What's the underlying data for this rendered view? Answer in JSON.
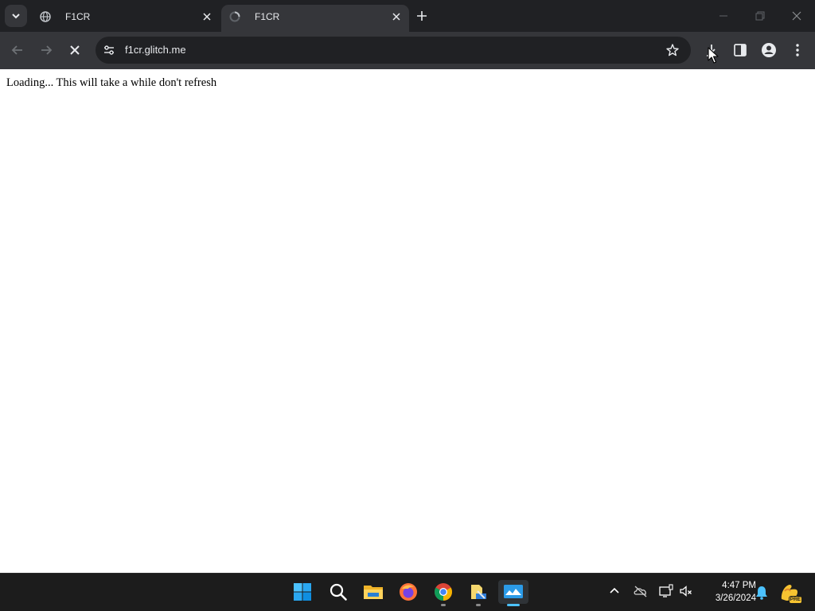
{
  "browser": {
    "tabs": [
      {
        "title": "F1CR",
        "active": false,
        "favicon": "globe-icon"
      },
      {
        "title": "F1CR",
        "active": true,
        "favicon": "loading-icon"
      }
    ],
    "address_bar": {
      "url": "f1cr.glitch.me"
    }
  },
  "page": {
    "text": "Loading... This will take a while don't refresh"
  },
  "taskbar": {
    "apps": [
      "windows-start-icon",
      "search-icon",
      "file-explorer-icon",
      "firefox-icon",
      "chrome-icon",
      "notepad-icon",
      "screen-recorder-icon"
    ],
    "clock": {
      "time": "4:47 PM",
      "date": "3/26/2024"
    },
    "pre_badge": "PRE"
  },
  "colors": {
    "tab_strip": "#202124",
    "toolbar": "#35363a",
    "taskbar": "#1c1c1c",
    "accent": "#4cc2ff"
  }
}
